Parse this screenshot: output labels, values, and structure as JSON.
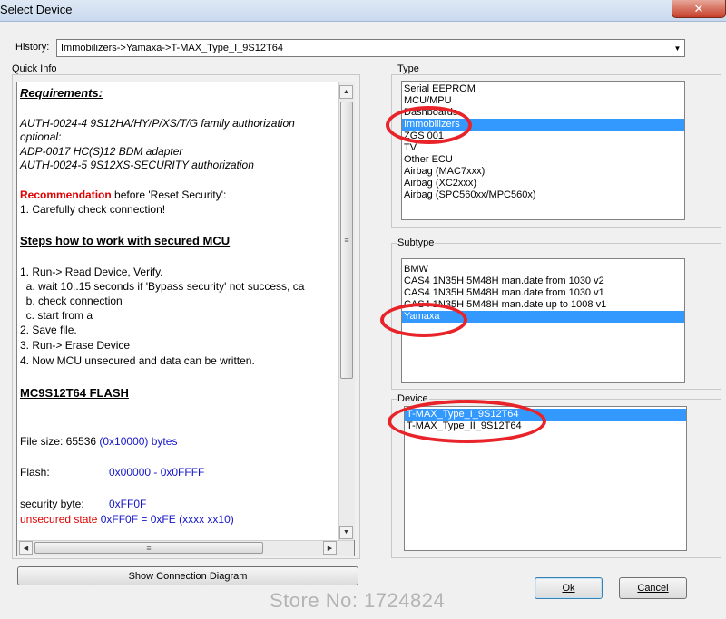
{
  "window": {
    "title": "Select Device",
    "close_glyph": "✕"
  },
  "history": {
    "label": "History:",
    "value": "Immobilizers->Yamaxa->T-MAX_Type_I_9S12T64",
    "arrow_glyph": "▼"
  },
  "quick_info": {
    "label": "Quick Info",
    "requirements_heading": "Requirements:",
    "req_line1": "AUTH-0024-4  9S12HA/HY/P/XS/T/G family authorization",
    "req_optional": "optional:",
    "req_line2": "ADP-0017  HC(S)12 BDM adapter",
    "req_line3": "AUTH-0024-5  9S12XS-SECURITY authorization",
    "recommendation_label": "Recommendation",
    "recommendation_rest": " before 'Reset Security':",
    "recommendation_step": "1. Carefully check connection!",
    "steps_heading": "Steps how to work with secured MCU",
    "step1": "1. Run-> Read Device, Verify.",
    "step1a": "  a. wait 10..15 seconds if 'Bypass security' not success, ca",
    "step1b": "  b. check connection",
    "step1c": "  c. start from a",
    "step2": "2. Save file.",
    "step3": "3. Run-> Erase Device",
    "step4": "4. Now MCU unsecured and data can be written.",
    "flash_heading": "MC9S12T64 FLASH",
    "file_size_label": "File size: 65536 ",
    "file_size_hex": "(0x10000) bytes",
    "flash_label": "Flash:",
    "flash_range": "0x00000 - 0x0FFFF",
    "security_label": "security byte:",
    "security_value": "0xFF0F",
    "unsecured_label": "unsecured state",
    "unsecured_value": " 0xFF0F = 0xFE (xxxx xx10)",
    "scroll_up": "▲",
    "scroll_down": "▼",
    "scroll_left": "◀",
    "scroll_right": "▶",
    "grip": "≡"
  },
  "show_diagram_button": "Show Connection Diagram",
  "type": {
    "label": "Type",
    "items": [
      "Serial EEPROM",
      "MCU/MPU",
      "Dashboards",
      "Immobilizers",
      "ZGS 001",
      "TV",
      "Other ECU",
      "Airbag (MAC7xxx)",
      "Airbag (XC2xxx)",
      "Airbag (SPC560xx/MPC560x)"
    ],
    "selected_index": 3
  },
  "subtype": {
    "label": "Subtype",
    "items": [
      "BMW",
      "CAS4 1N35H 5M48H man.date from 1030 v2",
      "CAS4 1N35H 5M48H man.date from 1030 v1",
      "CAS4 1N35H 5M48H man.date up to 1008 v1",
      "Yamaxa"
    ],
    "selected_index": 4
  },
  "device": {
    "label": "Device",
    "items": [
      "T-MAX_Type_I_9S12T64",
      "T-MAX_Type_II_9S12T64"
    ],
    "selected_index": 0
  },
  "ok_button": "Ok",
  "cancel_button": "Cancel",
  "watermark": "Store No: 1724824",
  "colors": {
    "selection": "#3399ff",
    "highlight_ellipse": "#e8232a",
    "warning_text": "#e00000",
    "value_text": "#1515c8"
  }
}
